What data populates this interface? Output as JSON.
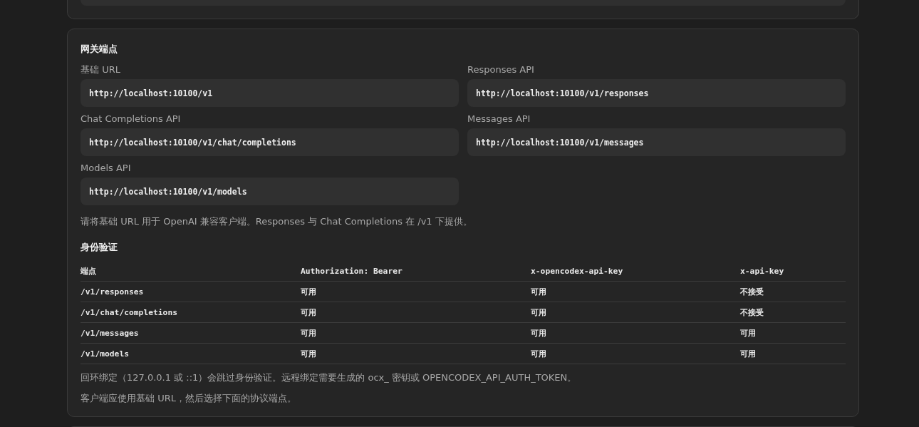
{
  "gateway": {
    "title": "网关端点",
    "endpoints": [
      {
        "label": "基础 URL",
        "value": "http://localhost:10100/v1"
      },
      {
        "label": "Responses API",
        "value": "http://localhost:10100/v1/responses"
      },
      {
        "label": "Chat Completions API",
        "value": "http://localhost:10100/v1/chat/completions"
      },
      {
        "label": "Messages API",
        "value": "http://localhost:10100/v1/messages"
      },
      {
        "label": "Models API",
        "value": "http://localhost:10100/v1/models"
      }
    ],
    "note": "请将基础 URL 用于 OpenAI 兼容客户端。Responses 与 Chat Completions 在 /v1 下提供。",
    "auth": {
      "title": "身份验证",
      "columns": [
        "端点",
        "Authorization: Bearer",
        "x-opencodex-api-key",
        "x-api-key"
      ],
      "rows": [
        [
          "/v1/responses",
          "可用",
          "可用",
          "不接受"
        ],
        [
          "/v1/chat/completions",
          "可用",
          "可用",
          "不接受"
        ],
        [
          "/v1/messages",
          "可用",
          "可用",
          "可用"
        ],
        [
          "/v1/models",
          "可用",
          "可用",
          "可用"
        ]
      ]
    },
    "footnotes": [
      "回环绑定（127.0.0.1 或 ::1）会跳过身份验证。远程绑定需要生成的 ocx_ 密钥或 OPENCODEX_API_AUTH_TOKEN。",
      "客户端应使用基础 URL，然后选择下面的协议端点。"
    ]
  }
}
